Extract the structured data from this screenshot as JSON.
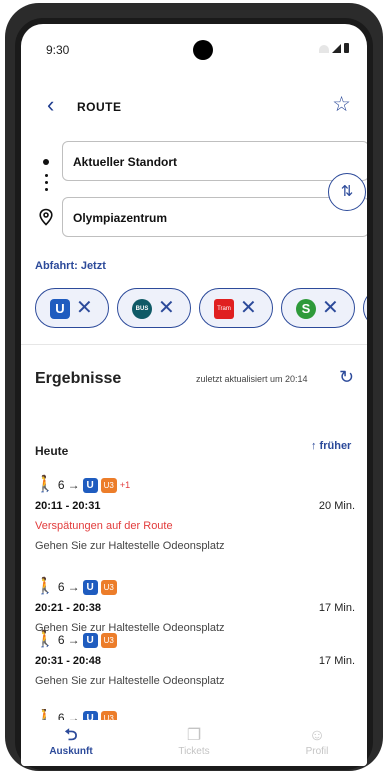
{
  "status_bar": {
    "time": "9:30"
  },
  "header": {
    "title": "ROUTE"
  },
  "route": {
    "from": "Aktueller Standort",
    "to": "Olympiazentrum",
    "departure": "Abfahrt: Jetzt"
  },
  "filters": [
    {
      "label": "U",
      "icon": "ubahn-logo"
    },
    {
      "label": "BUS",
      "icon": "bus-logo"
    },
    {
      "label": "Tram",
      "icon": "tram-logo"
    },
    {
      "label": "S",
      "icon": "sbahn-logo"
    }
  ],
  "results": {
    "title": "Ergebnisse",
    "updated": "zuletzt aktualisiert um 20:14",
    "day": "Heute",
    "earlier": "↑ früher",
    "connections": [
      {
        "walk": "6",
        "mode": "U",
        "line": "U3",
        "extra": "+1",
        "time": "20:11 - 20:31",
        "duration": "20 Min.",
        "warning": "Verspätungen auf der Route",
        "note": "Gehen Sie zur Haltestelle Odeonsplatz"
      },
      {
        "walk": "6",
        "mode": "U",
        "line": "U3",
        "time": "20:21 - 20:38",
        "duration": "17 Min.",
        "note": "Gehen Sie zur Haltestelle Odeonsplatz"
      },
      {
        "walk": "6",
        "mode": "U",
        "line": "U3",
        "time": "20:31 - 20:48",
        "duration": "17 Min.",
        "note": "Gehen Sie zur Haltestelle Odeonsplatz"
      },
      {
        "walk": "6",
        "mode": "U",
        "line": "U3"
      }
    ]
  },
  "nav": [
    {
      "label": "Auskunft",
      "icon": "route-icon",
      "active": true
    },
    {
      "label": "Tickets",
      "icon": "ticket-icon",
      "active": false
    },
    {
      "label": "Profil",
      "icon": "profile-icon",
      "active": false
    }
  ],
  "colors": {
    "accent": "#2c4a9a",
    "ubahn": "#1f5cbf",
    "u3": "#ec7d2a",
    "warning": "#e23c3c",
    "sbahn": "#2e9a3a",
    "tram": "#e02020",
    "bus": "#0f5a66"
  }
}
